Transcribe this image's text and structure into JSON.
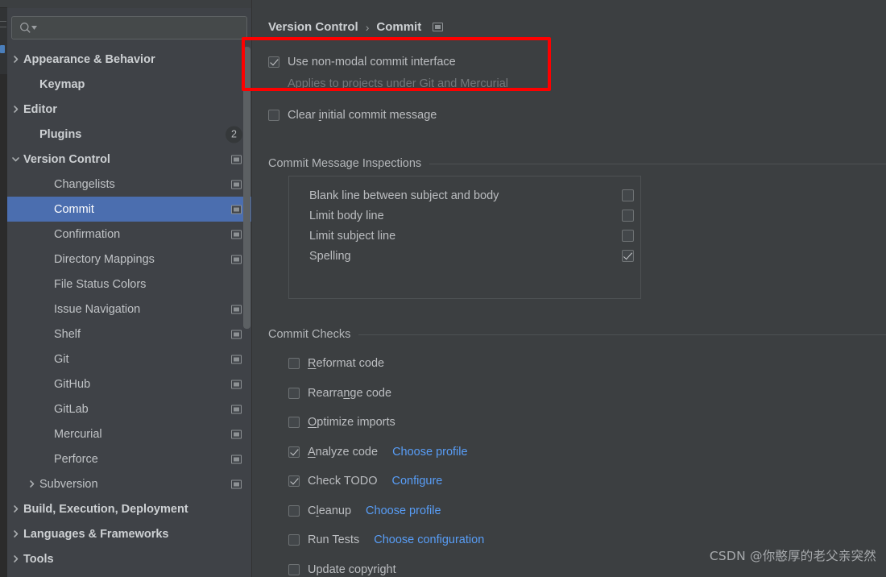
{
  "colors": {
    "window_bg": "#3c3f41",
    "sidebar_bg": "#3f4247",
    "selection": "#4b6eaf",
    "link": "#589df6",
    "highlight_box": "#fe0000",
    "text": "#bbbdc0"
  },
  "sidebar": {
    "search": {
      "value": "",
      "placeholder": ""
    },
    "items": [
      {
        "label": "Appearance & Behavior",
        "indent": 0,
        "arrow": "right",
        "bold": true,
        "icon": false,
        "selected": false
      },
      {
        "label": "Keymap",
        "indent": 1,
        "arrow": "none",
        "bold": true,
        "icon": false,
        "selected": false
      },
      {
        "label": "Editor",
        "indent": 0,
        "arrow": "right",
        "bold": true,
        "icon": false,
        "selected": false
      },
      {
        "label": "Plugins",
        "indent": 1,
        "arrow": "none",
        "bold": true,
        "icon": false,
        "selected": false,
        "badge": "2"
      },
      {
        "label": "Version Control",
        "indent": 0,
        "arrow": "down",
        "bold": true,
        "icon": true,
        "selected": false
      },
      {
        "label": "Changelists",
        "indent": 2,
        "arrow": "none",
        "bold": false,
        "icon": true,
        "selected": false
      },
      {
        "label": "Commit",
        "indent": 2,
        "arrow": "none",
        "bold": false,
        "icon": true,
        "selected": true
      },
      {
        "label": "Confirmation",
        "indent": 2,
        "arrow": "none",
        "bold": false,
        "icon": true,
        "selected": false
      },
      {
        "label": "Directory Mappings",
        "indent": 2,
        "arrow": "none",
        "bold": false,
        "icon": true,
        "selected": false
      },
      {
        "label": "File Status Colors",
        "indent": 2,
        "arrow": "none",
        "bold": false,
        "icon": false,
        "selected": false
      },
      {
        "label": "Issue Navigation",
        "indent": 2,
        "arrow": "none",
        "bold": false,
        "icon": true,
        "selected": false
      },
      {
        "label": "Shelf",
        "indent": 2,
        "arrow": "none",
        "bold": false,
        "icon": true,
        "selected": false
      },
      {
        "label": "Git",
        "indent": 2,
        "arrow": "none",
        "bold": false,
        "icon": true,
        "selected": false
      },
      {
        "label": "GitHub",
        "indent": 2,
        "arrow": "none",
        "bold": false,
        "icon": true,
        "selected": false
      },
      {
        "label": "GitLab",
        "indent": 2,
        "arrow": "none",
        "bold": false,
        "icon": true,
        "selected": false
      },
      {
        "label": "Mercurial",
        "indent": 2,
        "arrow": "none",
        "bold": false,
        "icon": true,
        "selected": false
      },
      {
        "label": "Perforce",
        "indent": 2,
        "arrow": "none",
        "bold": false,
        "icon": true,
        "selected": false
      },
      {
        "label": "Subversion",
        "indent": 1,
        "arrow": "right",
        "bold": false,
        "icon": true,
        "selected": false
      },
      {
        "label": "Build, Execution, Deployment",
        "indent": 0,
        "arrow": "right",
        "bold": true,
        "icon": false,
        "selected": false
      },
      {
        "label": "Languages & Frameworks",
        "indent": 0,
        "arrow": "right",
        "bold": true,
        "icon": false,
        "selected": false
      },
      {
        "label": "Tools",
        "indent": 0,
        "arrow": "right",
        "bold": true,
        "icon": false,
        "selected": false
      }
    ]
  },
  "breadcrumb": {
    "parent": "Version Control",
    "separator": "›",
    "current": "Commit"
  },
  "main": {
    "non_modal": {
      "label": "Use non-modal commit interface",
      "checked": true,
      "hint": "Applies to projects under Git and Mercurial"
    },
    "clear_initial": {
      "label_before": "Clear ",
      "label_mnemonic": "i",
      "label_after": "nitial commit message",
      "checked": false
    },
    "inspections_section": "Commit Message Inspections",
    "inspections": [
      {
        "label": "Blank line between subject and body",
        "checked": false
      },
      {
        "label": "Limit body line",
        "checked": false
      },
      {
        "label": "Limit subject line",
        "checked": false
      },
      {
        "label": "Spelling",
        "checked": true
      }
    ],
    "checks_section": "Commit Checks",
    "checks": [
      {
        "before": "",
        "mnemonic": "R",
        "after": "eformat code",
        "checked": false,
        "link": ""
      },
      {
        "before": "Rearra",
        "mnemonic": "n",
        "after": "ge code",
        "checked": false,
        "link": ""
      },
      {
        "before": "",
        "mnemonic": "O",
        "after": "ptimize imports",
        "checked": false,
        "link": ""
      },
      {
        "before": "",
        "mnemonic": "A",
        "after": "nalyze code",
        "checked": true,
        "link": "Choose profile"
      },
      {
        "before": "Check TODO",
        "mnemonic": "",
        "after": "",
        "checked": true,
        "link": "Configure"
      },
      {
        "before": "C",
        "mnemonic": "l",
        "after": "eanup",
        "checked": false,
        "link": "Choose profile"
      },
      {
        "before": "Run Tests",
        "mnemonic": "",
        "after": "",
        "checked": false,
        "link": "Choose configuration"
      },
      {
        "before": "Update copyright",
        "mnemonic": "",
        "after": "",
        "checked": false,
        "link": ""
      }
    ]
  },
  "watermark": "CSDN @你憨厚的老父亲突然"
}
